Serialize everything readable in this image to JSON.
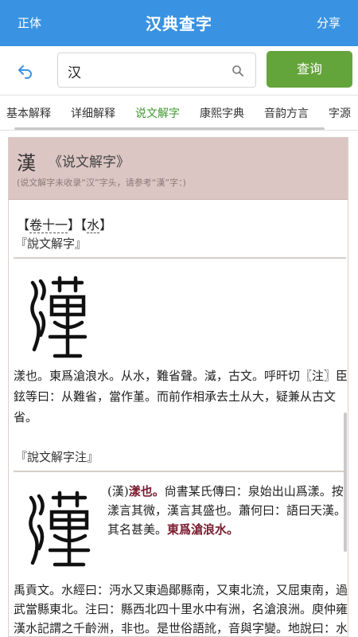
{
  "header": {
    "left": "正体",
    "title": "汉典查字",
    "right": "分享"
  },
  "search": {
    "value": "汉",
    "button": "查询"
  },
  "tabs": [
    {
      "label": "基本解释"
    },
    {
      "label": "详细解释"
    },
    {
      "label": "说文解字"
    },
    {
      "label": "康熙字典"
    },
    {
      "label": "音韵方言"
    },
    {
      "label": "字源"
    }
  ],
  "entry": {
    "char": "漢",
    "book": "《说文解字》",
    "note": "(说文解字未收录“汉”字头，请参考“漢”字：)",
    "juan": "卷十一",
    "bu": "水",
    "bracket_open": "【",
    "bracket_close": "】",
    "sec1": "『說文解字』",
    "def1": "漾也。東爲滄浪水。从水，難省聲。㵄，古文。呼旰切〖注〗臣鉉等曰：从難省，當作堇。而前作相承去土从大，疑兼从古文省。",
    "sec2": "『說文解字注』",
    "def2_a": "(漢)",
    "def2_hl1": "漾也。",
    "def2_b": "尙書某氏傳曰：泉始出山爲漾。按漾言其微，漢言其盛也。蕭何曰：語曰天漢。其名甚美。",
    "def2_hl2": "東爲滄浪水。",
    "def2_c": "禹貢文。水經曰：沔水又東過鄖縣南，又東北流，又屈東南，過武當縣東北。注曰：縣西北四十里水中有洲，名滄浪洲。庾仲雍漢水記謂之千齡洲，非也。是世俗語訛，音與字變。地說曰：水出荊山，東"
  },
  "colors": {
    "header": "#3a93e2",
    "button": "#64a53b",
    "active_tab": "#3e9a2c",
    "entry_bg": "#dcc6c3",
    "highlight": "#7a1d2f"
  }
}
